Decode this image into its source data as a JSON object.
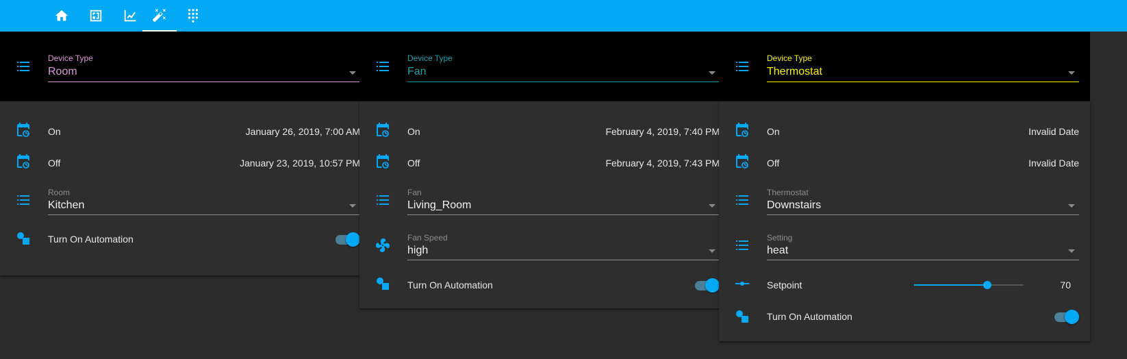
{
  "colors": {
    "accent": "#03a9f4",
    "room": "#da96d8",
    "fan": "#18a0a6",
    "thermostat": "#f7f500"
  },
  "nav": {
    "tabs": [
      "home-icon",
      "floorplan-icon",
      "chart-line-icon",
      "magic-wand-icon",
      "dialpad-icon"
    ],
    "active": "magic-wand-icon"
  },
  "columns": [
    {
      "device_type_label": "Device Type",
      "device_type_value": "Room",
      "on_label": "On",
      "on_value": "January 26, 2019, 7:00 AM",
      "off_label": "Off",
      "off_value": "January 23, 2019, 10:57 PM",
      "select1_label": "Room",
      "select1_value": "Kitchen",
      "automation_label": "Turn On Automation",
      "automation_on": true
    },
    {
      "device_type_label": "Device Type",
      "device_type_value": "Fan",
      "on_label": "On",
      "on_value": "February 4, 2019, 7:40 PM",
      "off_label": "Off",
      "off_value": "February 4, 2019, 7:43 PM",
      "select1_label": "Fan",
      "select1_value": "Living_Room",
      "select2_label": "Fan Speed",
      "select2_value": "high",
      "automation_label": "Turn On Automation",
      "automation_on": true
    },
    {
      "device_type_label": "Device Type",
      "device_type_value": "Thermostat",
      "on_label": "On",
      "on_value": "Invalid Date",
      "off_label": "Off",
      "off_value": "Invalid Date",
      "select1_label": "Thermostat",
      "select1_value": "Downstairs",
      "select2_label": "Setting",
      "select2_value": "heat",
      "setpoint_label": "Setpoint",
      "setpoint_value": "70",
      "setpoint_fraction": 0.67,
      "automation_label": "Turn On Automation",
      "automation_on": true
    }
  ]
}
